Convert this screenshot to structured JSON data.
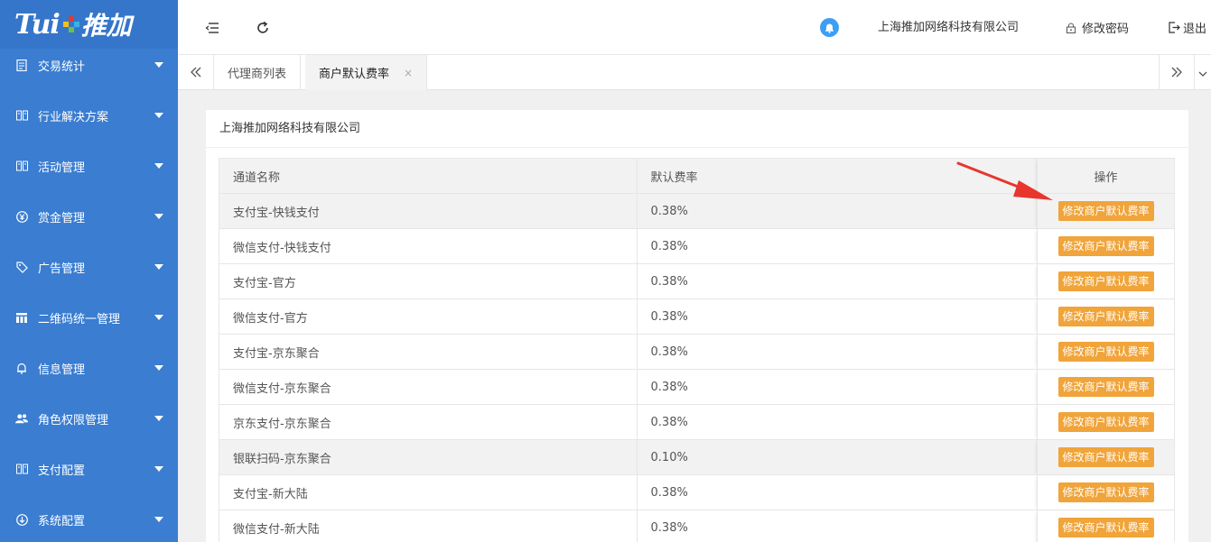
{
  "logo": {
    "text": "Tui",
    "cn": "推加"
  },
  "sidebar": {
    "items": [
      {
        "label": "交易统计",
        "icon": "document-icon"
      },
      {
        "label": "行业解决方案",
        "icon": "book-icon"
      },
      {
        "label": "活动管理",
        "icon": "book-icon"
      },
      {
        "label": "赏金管理",
        "icon": "yen-icon"
      },
      {
        "label": "广告管理",
        "icon": "tag-icon"
      },
      {
        "label": "二维码统一管理",
        "icon": "grid-icon"
      },
      {
        "label": "信息管理",
        "icon": "bell-icon"
      },
      {
        "label": "角色权限管理",
        "icon": "users-icon"
      },
      {
        "label": "支付配置",
        "icon": "book-icon"
      },
      {
        "label": "系统配置",
        "icon": "download-circle-icon"
      }
    ]
  },
  "header": {
    "company": "上海推加网络科技有限公司",
    "change_password": "修改密码",
    "logout": "退出"
  },
  "tabs": [
    {
      "label": "代理商列表"
    },
    {
      "label": "商户默认费率"
    }
  ],
  "card": {
    "title": "上海推加网络科技有限公司",
    "columns": [
      "通道名称",
      "默认费率",
      "操作"
    ],
    "button_label": "修改商户默认费率",
    "rows": [
      {
        "name": "支付宝-快钱支付",
        "rate": "0.38%"
      },
      {
        "name": "微信支付-快钱支付",
        "rate": "0.38%"
      },
      {
        "name": "支付宝-官方",
        "rate": "0.38%"
      },
      {
        "name": "微信支付-官方",
        "rate": "0.38%"
      },
      {
        "name": "支付宝-京东聚合",
        "rate": "0.38%"
      },
      {
        "name": "微信支付-京东聚合",
        "rate": "0.38%"
      },
      {
        "name": "京东支付-京东聚合",
        "rate": "0.38%"
      },
      {
        "name": "银联扫码-京东聚合",
        "rate": "0.10%"
      },
      {
        "name": "支付宝-新大陆",
        "rate": "0.38%"
      },
      {
        "name": "微信支付-新大陆",
        "rate": "0.38%"
      }
    ]
  },
  "colors": {
    "sidebar": "#3a7dd1",
    "button": "#f0a43a",
    "arrow": "#e8362d",
    "bell": "#3e9ef5"
  }
}
